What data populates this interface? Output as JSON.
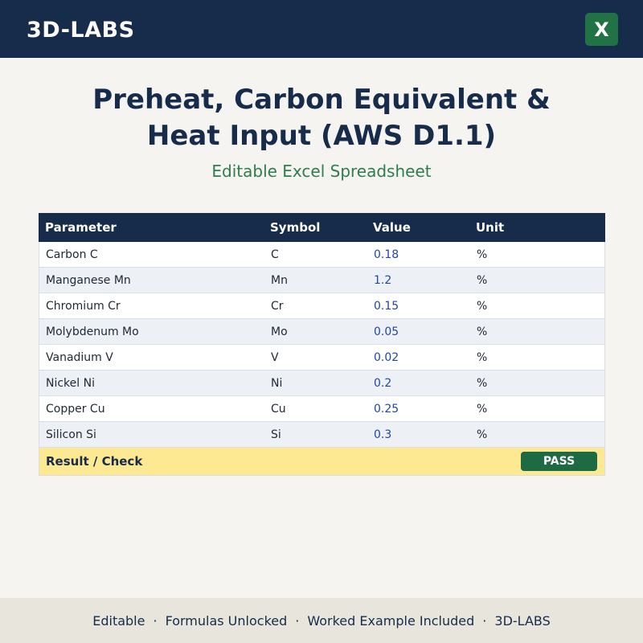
{
  "header": {
    "brand": "3D-LABS",
    "excel_icon_glyph": "X",
    "icon_color": "#217346"
  },
  "title_line1": "Preheat, Carbon Equivalent &",
  "title_line2": "Heat Input (AWS D1.1)",
  "subtitle": "Editable Excel Spreadsheet",
  "table": {
    "headers": [
      "Parameter",
      "Symbol",
      "Value",
      "Unit"
    ],
    "rows": [
      {
        "param": "Carbon C",
        "symbol": "C",
        "value": "0.18",
        "unit": "%"
      },
      {
        "param": "Manganese Mn",
        "symbol": "Mn",
        "value": "1.2",
        "unit": "%"
      },
      {
        "param": "Chromium Cr",
        "symbol": "Cr",
        "value": "0.15",
        "unit": "%"
      },
      {
        "param": "Molybdenum Mo",
        "symbol": "Mo",
        "value": "0.05",
        "unit": "%"
      },
      {
        "param": "Vanadium V",
        "symbol": "V",
        "value": "0.02",
        "unit": "%"
      },
      {
        "param": "Nickel Ni",
        "symbol": "Ni",
        "value": "0.2",
        "unit": "%"
      },
      {
        "param": "Copper Cu",
        "symbol": "Cu",
        "value": "0.25",
        "unit": "%"
      },
      {
        "param": "Silicon Si",
        "symbol": "Si",
        "value": "0.3",
        "unit": "%"
      }
    ],
    "result_label": "Result / Check",
    "result_status": "PASS"
  },
  "footer": {
    "items": [
      "Editable",
      "Formulas Unlocked",
      "Worked Example Included",
      "3D-LABS"
    ],
    "separator": "·"
  },
  "colors": {
    "navy": "#172b4b",
    "green": "#2e7d4f",
    "pass": "#1e6b43",
    "value_blue": "#1f47a8",
    "result_bg": "#fde992"
  }
}
